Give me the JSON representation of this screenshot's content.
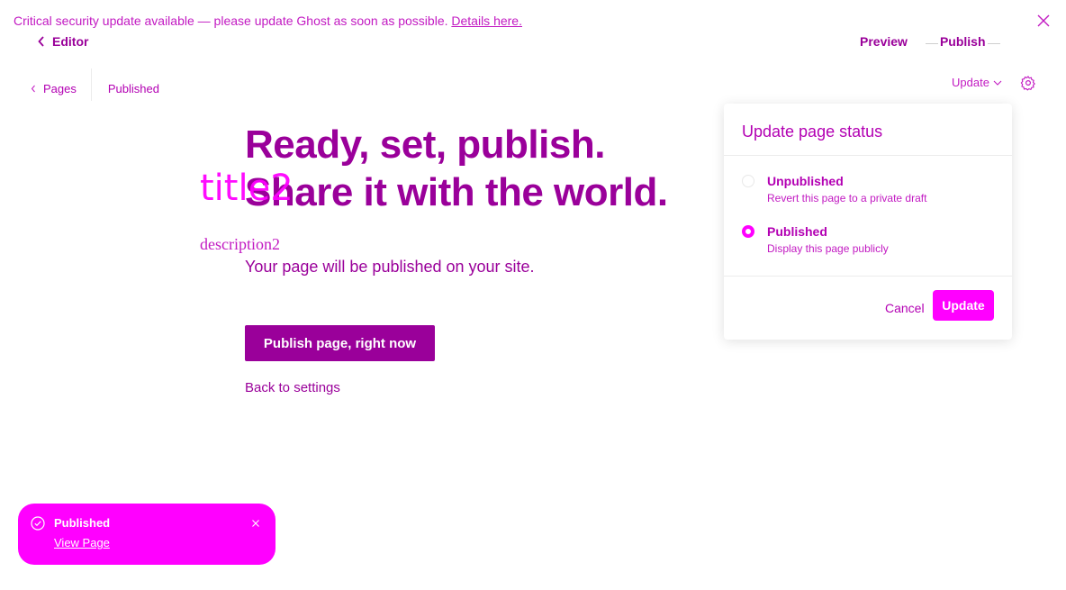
{
  "alert": {
    "message": "Critical security update available — please update Ghost as soon as possible.",
    "link": "Details here."
  },
  "header": {
    "back_label": "Editor",
    "preview": "Preview",
    "publish": "Publish"
  },
  "subheader": {
    "pages": "Pages",
    "status": "Published",
    "update_dropdown": "Update"
  },
  "main": {
    "headline_line1": "Ready, set, publish.",
    "headline_line2": "Share it with the world.",
    "overlay_title": "title2",
    "overlay_description": "description2",
    "lede": "Your page will be published on your site.",
    "publish_button": "Publish page, right now",
    "back_to_settings": "Back to settings"
  },
  "popover": {
    "title": "Update page status",
    "options": [
      {
        "label": "Unpublished",
        "description": "Revert this page to a private draft",
        "selected": false
      },
      {
        "label": "Published",
        "description": "Display this page publicly",
        "selected": true
      }
    ],
    "cancel": "Cancel",
    "update": "Update"
  },
  "toast": {
    "title": "Published",
    "link": "View Page"
  },
  "colors": {
    "accent": "#ff00ff",
    "primary": "#9a009a",
    "text": "#b300b3"
  }
}
